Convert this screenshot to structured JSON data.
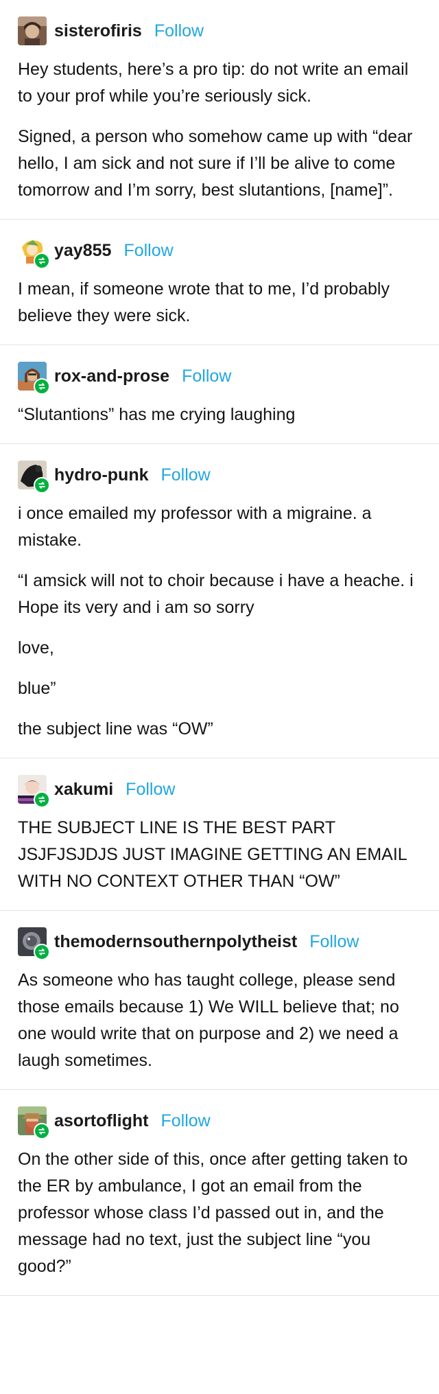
{
  "follow_label": "Follow",
  "colors": {
    "follow": "#1fa7e1",
    "reblog_badge": "#00b140",
    "divider": "#e3e3e3"
  },
  "posts": [
    {
      "username": "sisterofiris",
      "reblog_icon": false,
      "paragraphs": [
        "Hey students, here’s a pro tip: do not write an email to your prof while you’re seriously sick.",
        "Signed, a person who somehow came up with “dear hello, I am sick and not sure if I’ll be alive to come tomorrow and I’m sorry, best slutantions, [name]”."
      ]
    },
    {
      "username": "yay855",
      "reblog_icon": true,
      "paragraphs": [
        "I mean, if someone wrote that to me, I’d probably believe they were sick."
      ]
    },
    {
      "username": "rox-and-prose",
      "reblog_icon": true,
      "paragraphs": [
        "“Slutantions” has me crying laughing"
      ]
    },
    {
      "username": "hydro-punk",
      "reblog_icon": true,
      "paragraphs": [
        "i once emailed my professor with a migraine. a mistake.",
        "“I amsick will not to choir because i have a heache. i Hope its very and i am so sorry",
        "love,",
        "blue”",
        "the subject line was “OW”"
      ]
    },
    {
      "username": "xakumi",
      "reblog_icon": true,
      "paragraphs": [
        "THE SUBJECT LINE IS THE BEST PART JSJFJSJDJS JUST IMAGINE GETTING AN EMAIL WITH NO CONTEXT OTHER THAN “OW”"
      ]
    },
    {
      "username": "themodernsouthernpolytheist",
      "reblog_icon": true,
      "paragraphs": [
        "As someone who has taught college, please send those emails because 1) We WILL believe that; no one would write that on purpose and 2) we need a laugh sometimes."
      ]
    },
    {
      "username": "asortoflight",
      "reblog_icon": true,
      "paragraphs": [
        "On the other side of this, once after getting taken to the ER by ambulance, I got an email from the professor whose class I’d passed out in, and the message had no text, just the subject line “you good?”"
      ]
    }
  ]
}
